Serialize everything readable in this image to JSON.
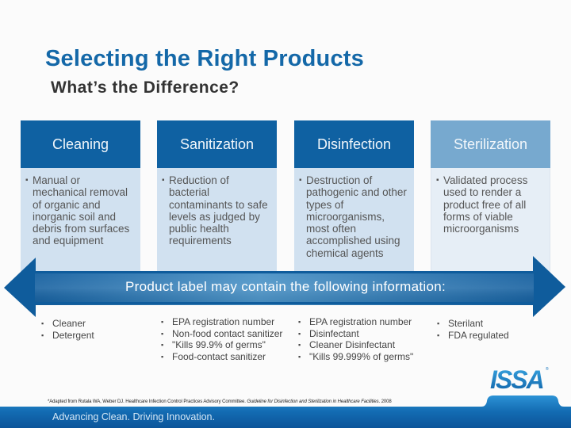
{
  "header": {
    "title": "Selecting the Right Products",
    "subtitle": "What’s the Difference?"
  },
  "columns": [
    {
      "title": "Cleaning",
      "bullet": "▪",
      "description": "Manual or mechanical removal of organic and inorganic soil and debris from surfaces and equipment"
    },
    {
      "title": "Sanitization",
      "bullet": "▪",
      "description": "Reduction of bacterial contaminants to safe levels as judged by public health requirements"
    },
    {
      "title": "Disinfection",
      "bullet": "▪",
      "description": "Destruction of pathogenic and other types of microorganisms, most often accomplished using chemical agents"
    },
    {
      "title": "Sterilization",
      "bullet": "▪",
      "description": "Validated process used to render a product free of all forms of viable microorganisms"
    }
  ],
  "arrow": {
    "label": "Product label may contain the following information:"
  },
  "label_info": {
    "bullet": "▪",
    "cleaning": [
      "Cleaner",
      "Detergent"
    ],
    "sanitization": [
      "EPA registration number",
      "Non-food contact sanitizer",
      "\"Kills 99.9% of germs\"",
      "Food-contact sanitizer"
    ],
    "disinfection": [
      "EPA registration number",
      "Disinfectant",
      "Cleaner Disinfectant",
      "\"Kills 99.999% of germs\""
    ],
    "sterilization": [
      "Sterilant",
      "FDA regulated"
    ]
  },
  "footnote": {
    "prefix": "*Adapted from Rutala WA, Weber DJ. Healthcare Infection Control Practices Advisory Committee. ",
    "italic": "Guideline for Disinfection and Sterilization in Healthcare Facilities",
    "suffix": ". 2008"
  },
  "footer": {
    "tagline": "Advancing Clean. Driving Innovation.",
    "logo": "ISSA",
    "logo_mark": "®"
  },
  "colors": {
    "title_blue": "#1468a8",
    "header_dark": "#0f61a2",
    "header_light": "#77a9cf",
    "body_dark": "#d1e1f0",
    "body_light": "#e6eef6",
    "arrow_dark": "#0f5c9c",
    "arrow_light": "#4a92c6"
  }
}
